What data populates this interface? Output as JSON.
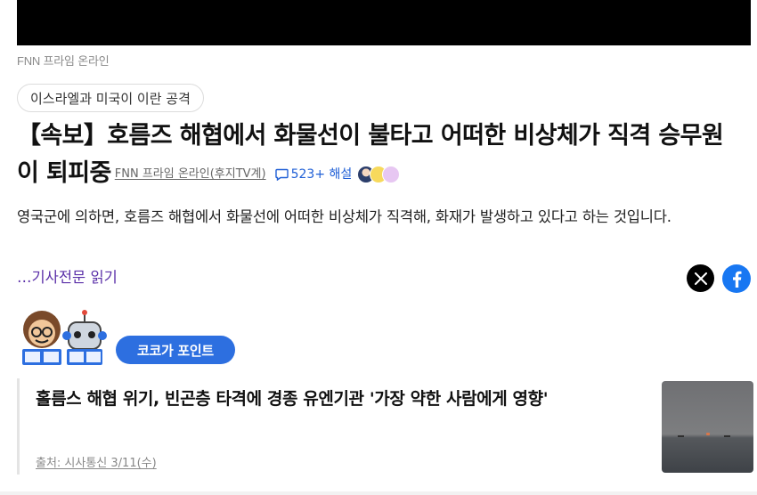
{
  "source_caption": "FNN 프라임 온라인",
  "topic_chip": "이스라엘과 미국이 이란 공격",
  "headline": "【속보】호름즈 해협에서 화물선이 불타고 어떠한 비상체가 직격 승무원이 퇴피중",
  "publisher": "FNN 프라임 온라인(후지TV계)",
  "comment_count": "523",
  "comment_label": "+ 해설",
  "summary": "영국군에 의하면, 호름즈 해협에서 화물선에 어떠한 비상체가 직격해, 화재가 발생하고 있다고 하는 것입니다.",
  "read_more": "…기사전문 읽기",
  "point_badge": "코코가 포인트",
  "related": {
    "title": "홀름스 해협 위기, 빈곤층 타격에 경종 유엔기관 '가장 약한 사람에게 영향'",
    "source": "출처: 시사통신 3/11(수)"
  },
  "colors": {
    "accent": "#2d6fe0",
    "read_more": "#5a2fa8",
    "facebook": "#1877f2",
    "comment": "#1f5fd6"
  },
  "icons": [
    "x-logo-icon",
    "facebook-icon",
    "comment-icon",
    "mascot-icon"
  ]
}
